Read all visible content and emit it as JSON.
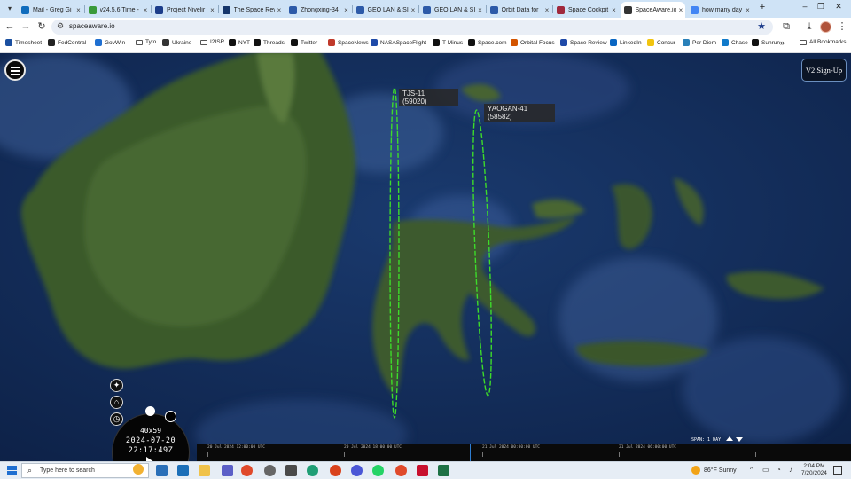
{
  "browser": {
    "tabs": [
      {
        "title": "Mail - Greg Gi",
        "fav": "#0f6cbd"
      },
      {
        "title": "v24.5.6 Time -",
        "fav": "#3a9a3a"
      },
      {
        "title": "Project Nivelir",
        "fav": "#1c3d8a"
      },
      {
        "title": "The Space Rev",
        "fav": "#14356b"
      },
      {
        "title": "Zhongxing-34",
        "fav": "#2d5aa8"
      },
      {
        "title": "GEO LAN & SI",
        "fav": "#2d5aa8"
      },
      {
        "title": "GEO LAN & SI",
        "fav": "#2d5aa8"
      },
      {
        "title": "Orbit Data for",
        "fav": "#2d5aa8"
      },
      {
        "title": "Space Cockpit",
        "fav": "#a0283c"
      },
      {
        "title": "SpaceAware.io",
        "fav": "#333333"
      },
      {
        "title": "how many day",
        "fav": "#4285f4"
      }
    ],
    "active_tab": 9,
    "new_tab": "+",
    "url": "spaceaware.io",
    "bookmarks": [
      {
        "label": "Timesheet",
        "kind": "icon",
        "color": "#1a4fa0"
      },
      {
        "label": "FedCentral",
        "kind": "icon",
        "color": "#222222"
      },
      {
        "label": "GovWin",
        "kind": "icon",
        "color": "#1f6fd1"
      },
      {
        "label": "Tyto",
        "kind": "folder"
      },
      {
        "label": "Ukraine",
        "kind": "icon",
        "color": "#333333"
      },
      {
        "label": "I2ISR",
        "kind": "folder"
      },
      {
        "label": "NYT",
        "kind": "icon",
        "color": "#111111"
      },
      {
        "label": "Threads",
        "kind": "icon",
        "color": "#111111"
      },
      {
        "label": "Twitter",
        "kind": "icon",
        "color": "#111111"
      },
      {
        "label": "SpaceNews",
        "kind": "icon",
        "color": "#c0392b"
      },
      {
        "label": "NASASpaceFlight",
        "kind": "icon",
        "color": "#1f4aa8"
      },
      {
        "label": "T-Minus",
        "kind": "icon",
        "color": "#111111"
      },
      {
        "label": "Space.com",
        "kind": "icon",
        "color": "#111111"
      },
      {
        "label": "Orbital Focus",
        "kind": "icon",
        "color": "#d35400"
      },
      {
        "label": "Space Review",
        "kind": "icon",
        "color": "#1f4aa8"
      },
      {
        "label": "LinkedIn",
        "kind": "icon",
        "color": "#0a66c2"
      },
      {
        "label": "Concur",
        "kind": "icon",
        "color": "#f1c40f"
      },
      {
        "label": "Per Diem",
        "kind": "icon",
        "color": "#2980b9"
      },
      {
        "label": "Chase",
        "kind": "icon",
        "color": "#117aca"
      },
      {
        "label": "Sunrun",
        "kind": "icon",
        "color": "#111111"
      }
    ],
    "more_bookmarks": "»",
    "all_bookmarks": "All Bookmarks"
  },
  "app": {
    "signup_label": "V2 Sign-Up",
    "satellites": [
      {
        "name": "TJS-11",
        "norad": "(59020)"
      },
      {
        "name": "YAOGAN-41",
        "norad": "(58582)"
      }
    ],
    "orbit_color": "#3ddc2a",
    "clock": {
      "fov": "40x59",
      "date": "2024-07-20",
      "time": "22:17:49Z"
    },
    "timeline_ticks": [
      "20 Jul 2024 12:00:00 UTC",
      "20 Jul 2024 18:00:00 UTC",
      "21 Jul 2024 00:00:00 UTC",
      "21 Jul 2024 06:00:00 UTC"
    ],
    "span_label": "SPAN: 1 DAY"
  },
  "taskbar": {
    "search_placeholder": "Type here to search",
    "weather_temp": "86°F",
    "weather_desc": "Sunny",
    "time": "2:04 PM",
    "date": "7/20/2024"
  }
}
